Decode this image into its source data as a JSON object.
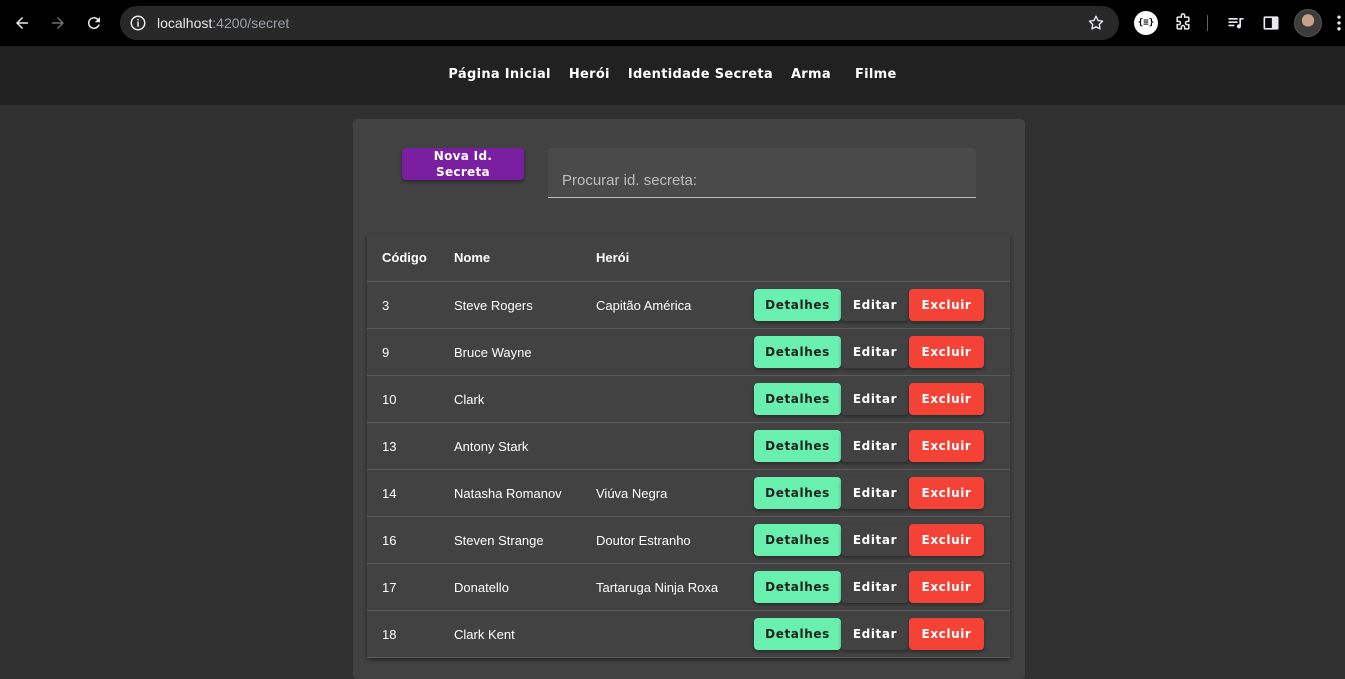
{
  "browser": {
    "url_host": "localhost",
    "url_path": ":4200/secret",
    "extension_label": "{≡}"
  },
  "nav": {
    "links": [
      "Página Inicial",
      "Herói",
      "Identidade Secreta",
      "Arma",
      "Filme"
    ]
  },
  "toolbar": {
    "new_button_label": "Nova Id. Secreta",
    "search_placeholder": "Procurar id. secreta:"
  },
  "table": {
    "headers": {
      "code": "Código",
      "name": "Nome",
      "hero": "Herói"
    },
    "action_labels": {
      "details": "Detalhes",
      "edit": "Editar",
      "delete": "Excluir"
    },
    "rows": [
      {
        "code": "3",
        "name": "Steve Rogers",
        "hero": "Capitão América"
      },
      {
        "code": "9",
        "name": "Bruce Wayne",
        "hero": ""
      },
      {
        "code": "10",
        "name": "Clark",
        "hero": ""
      },
      {
        "code": "13",
        "name": "Antony Stark",
        "hero": ""
      },
      {
        "code": "14",
        "name": "Natasha Romanov",
        "hero": "Viúva Negra"
      },
      {
        "code": "16",
        "name": "Steven Strange",
        "hero": "Doutor Estranho"
      },
      {
        "code": "17",
        "name": "Donatello",
        "hero": "Tartaruga Ninja Roxa"
      },
      {
        "code": "18",
        "name": "Clark Kent",
        "hero": ""
      }
    ]
  },
  "colors": {
    "accent_purple": "#7b1fa2",
    "details_green": "#69f0ae",
    "delete_red": "#f44336",
    "card_bg": "#424242"
  }
}
